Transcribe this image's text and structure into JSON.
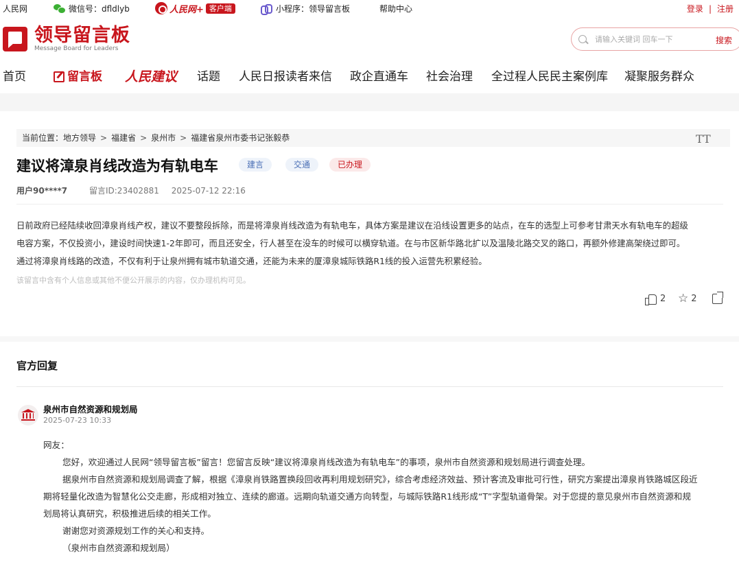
{
  "topbar": {
    "site": "人民网",
    "wechat": "微信号：dfldlyb",
    "client_name": "人民网+",
    "client_tag": "客户端",
    "mini_program": "小程序：领导留言板",
    "help": "帮助中心",
    "login": "登录",
    "divider": "|",
    "register": "注册"
  },
  "logo": {
    "cn": "领导留言板",
    "en": "Message Board for Leaders"
  },
  "search": {
    "placeholder": "请输入关键词 回车一下",
    "button": "搜索"
  },
  "nav": {
    "home": "首页",
    "board": "留言板",
    "jianyi": "人民建议",
    "topics": "话题",
    "letters": "人民日报读者来信",
    "enterprise": "政企直通车",
    "governance": "社会治理",
    "cases": "全过程人民民主案例库",
    "service": "凝聚服务群众"
  },
  "breadcrumb": {
    "prefix": "当前位置：地方领导",
    "sep": ">",
    "province": "福建省",
    "city": "泉州市",
    "leader": "福建省泉州市委书记张毅恭"
  },
  "font_size_toggle": "TT",
  "message": {
    "title": "建议将漳泉肖线改造为有轨电车",
    "tags": [
      "建言",
      "交通",
      "已办理"
    ],
    "user": "用户90****7",
    "id": "留言ID:23402881",
    "date": "2025-07-12 22:16",
    "body_lines": [
      "日前政府已经陆续收回漳泉肖线产权，建议不要整段拆除，而是将漳泉肖线改造为有轨电车，具体方案是建议在沿线设置更多的站点，在车的选型上可参考甘肃天水有轨电车的超级",
      "电容方案，不仅投资小，建设时间快速1-2年即可，而且还安全，行人甚至在没车的时候可以横穿轨道。在与市区新华路北扩以及温陵北路交叉的路口，再额外修建高架绕过即可。",
      "通过将漳泉肖线路的改造，不仅有利于让泉州拥有城市轨道交通，还能为未来的厦漳泉城际铁路R1线的投入运营先积累经验。"
    ],
    "notice": "该留言中含有个人信息或其他不便公开展示的内容，仅办理机构可见。",
    "likes": "2",
    "favorites": "2"
  },
  "reply": {
    "heading": "官方回复",
    "org": "泉州市自然资源和规划局",
    "time": "2025-07-23 10:33",
    "greeting": "网友：",
    "para1": "您好，欢迎通过人民网“领导留言板”留言！您留言反映“建议将漳泉肖线改造为有轨电车”的事项，泉州市自然资源和规划局进行调查处理。",
    "para2_lines": [
      "据泉州市自然资源和规划局调查了解，根据《漳泉肖铁路置换段回收再利用规划研究》，综合考虑经济效益、预计客流及审批可行性，研究方案提出漳泉肖铁路城区段近",
      "期将轻量化改造为智慧化公交走廊，形成相对独立、连续的廊道。远期向轨道交通方向转型，与城际铁路R1线形成“T”字型轨道骨架。对于您提的意见泉州市自然资源和规",
      "划局将认真研究，积极推进后续的相关工作。"
    ],
    "para3": "谢谢您对资源规划工作的关心和支持。",
    "signature": "（泉州市自然资源和规划局）"
  },
  "colors": {
    "brand_red": "#c8161d",
    "tag_blue": "#4a6fb5"
  }
}
